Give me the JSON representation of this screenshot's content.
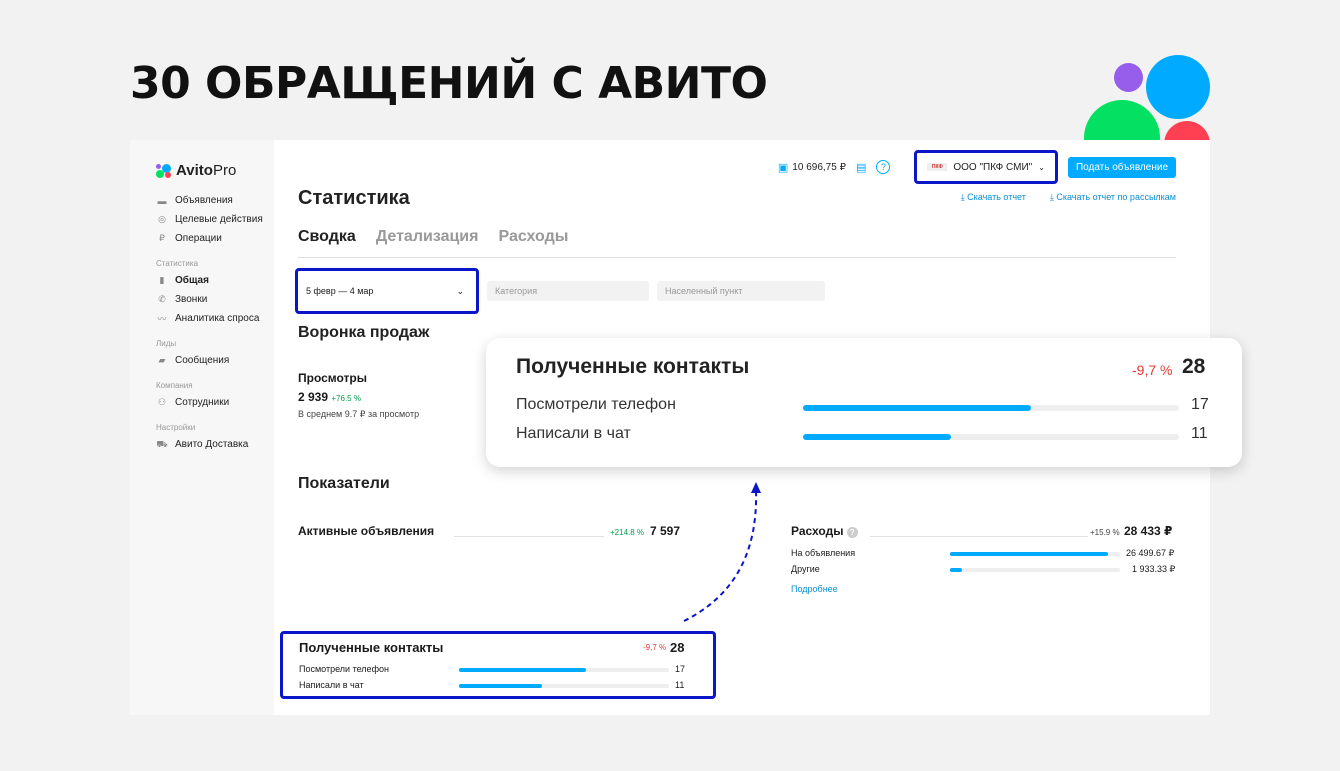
{
  "headline": "30 ОБРАЩЕНИЙ С АВИТО",
  "sidebar": {
    "logo_main": "Avito",
    "logo_sub": "Pro",
    "items_top": [
      {
        "icon": "ads-icon",
        "glyph": "▬",
        "label": "Объявления"
      },
      {
        "icon": "target-icon",
        "glyph": "◎",
        "label": "Целевые действия"
      },
      {
        "icon": "operations-icon",
        "glyph": "₽",
        "label": "Операции"
      }
    ],
    "section_stats": "Статистика",
    "items_stats": [
      {
        "icon": "bar-chart-icon",
        "glyph": "▮",
        "label": "Общая",
        "active": true
      },
      {
        "icon": "phone-icon",
        "glyph": "✆",
        "label": "Звонки"
      },
      {
        "icon": "trend-icon",
        "glyph": "〰",
        "label": "Аналитика спроса"
      }
    ],
    "section_leads": "Лиды",
    "items_leads": [
      {
        "icon": "chat-icon",
        "glyph": "▰",
        "label": "Сообщения"
      }
    ],
    "section_company": "Компания",
    "items_company": [
      {
        "icon": "staff-icon",
        "glyph": "⚇",
        "label": "Сотрудники"
      }
    ],
    "section_settings": "Настройки",
    "items_settings": [
      {
        "icon": "truck-icon",
        "glyph": "⛟",
        "label": "Авито Доставка"
      }
    ]
  },
  "topbar": {
    "balance": "10 696,75 ₽",
    "company_name": "ООО \"ПКФ СМИ\"",
    "post_button": "Подать объявление"
  },
  "page": {
    "title": "Статистика",
    "download_report": "Скачать отчет",
    "download_mailing": "Скачать отчет по рассылкам",
    "tabs": [
      "Сводка",
      "Детализация",
      "Расходы"
    ],
    "date_range": "5 февр — 4 мар",
    "category_placeholder": "Категория",
    "locality_placeholder": "Населенный пункт"
  },
  "funnel": {
    "title": "Воронка продаж",
    "views_label": "Просмотры",
    "views_value": "2 939",
    "views_delta": "+76.5 %",
    "views_avg": "В среднем 9.7 ₽ за просмотр"
  },
  "indicators": {
    "title": "Показатели",
    "active_ads_label": "Активные объявления",
    "active_ads_delta": "+214.8 %",
    "active_ads_value": "7 597",
    "expenses_label": "Расходы",
    "expenses_delta": "+15.9 %",
    "expenses_value": "28 433 ₽",
    "expenses_rows": [
      {
        "label": "На объявления",
        "value": "26 499.67 ₽",
        "share": 0.932
      },
      {
        "label": "Другие",
        "value": "1 933.33 ₽",
        "share": 0.068
      }
    ],
    "more_link": "Подробнее"
  },
  "contacts": {
    "title": "Полученные контакты",
    "delta": "-9,7 %",
    "total": "28",
    "rows": [
      {
        "label": "Посмотрели телефон",
        "value": "17",
        "share": 0.607
      },
      {
        "label": "Написали в чат",
        "value": "11",
        "share": 0.393
      }
    ]
  },
  "colors": {
    "accent": "#00aaff",
    "highlight": "#0a16c8",
    "negative": "#e53935",
    "positive": "#04a050"
  }
}
